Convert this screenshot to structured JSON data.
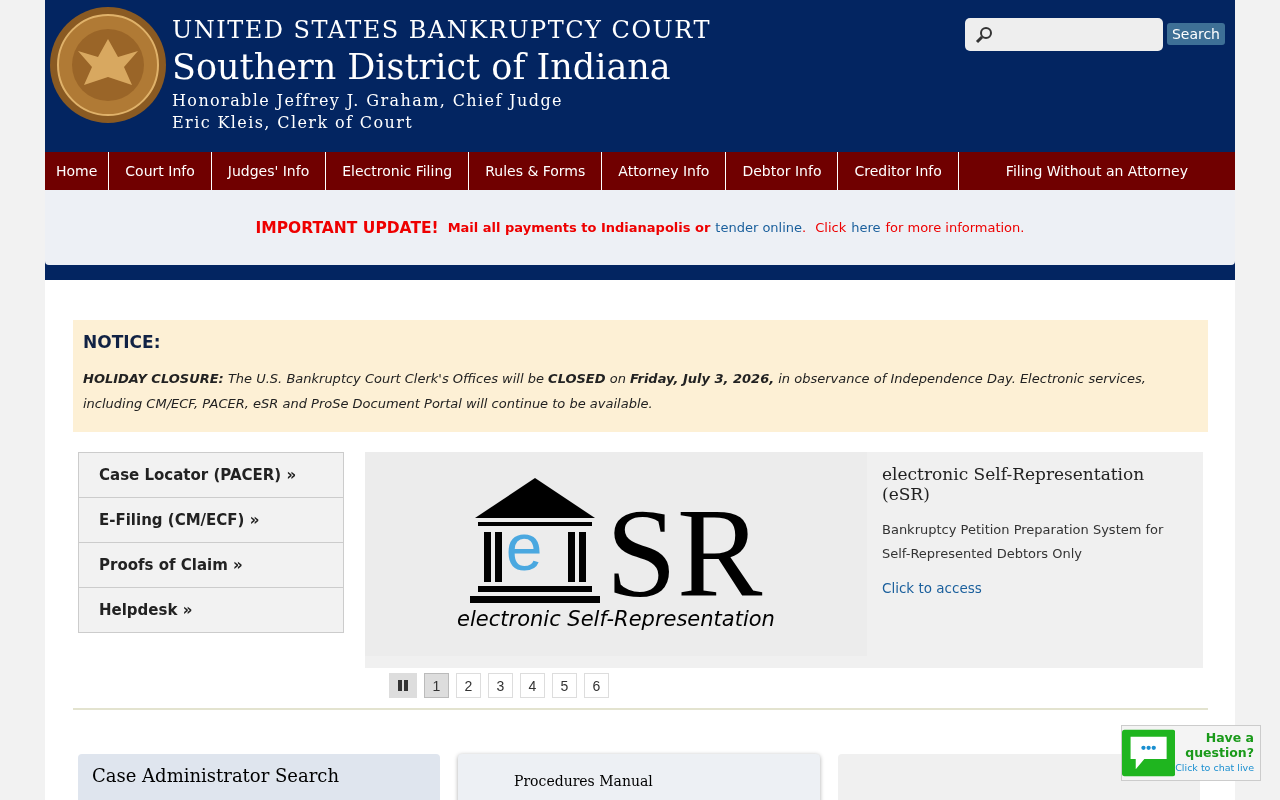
{
  "header": {
    "court": "UNITED STATES BANKRUPTCY COURT",
    "district": "Southern District of Indiana",
    "judge": "Honorable Jeffrey J. Graham, Chief Judge",
    "clerk": "Eric Kleis, Clerk of Court"
  },
  "search": {
    "button": "Search"
  },
  "nav": [
    {
      "label": "Home"
    },
    {
      "label": "Court Info"
    },
    {
      "label": "Judges' Info"
    },
    {
      "label": "Electronic Filing"
    },
    {
      "label": "Rules & Forms"
    },
    {
      "label": "Attorney Info"
    },
    {
      "label": "Debtor Info"
    },
    {
      "label": "Creditor Info"
    },
    {
      "label": "Filing Without an Attorney"
    }
  ],
  "update": {
    "headline": "IMPORTANT UPDATE!",
    "text": "Mail all payments to Indianapolis or",
    "link": "tender online",
    "after": ".",
    "click": "Click",
    "here": "here",
    "tail": "for more information."
  },
  "notice": {
    "title": "NOTICE:",
    "text": "**HOLIDAY CLOSURE:** The U.S. Bankruptcy Court Clerk's Offices will be **CLOSED** on **Friday, July 3, 2026,** in observance of Independence Day. Electronic services, including CM/ECF, PACER, eSR and ProSe Document Portal will continue to be available."
  },
  "quick_links": [
    {
      "label": "Case Locator (PACER) »"
    },
    {
      "label": "E-Filing (CM/ECF) »"
    },
    {
      "label": "Proofs of Claim »"
    },
    {
      "label": "Helpdesk »"
    }
  ],
  "slide": {
    "logo_letter": "e",
    "logo_text": "SR",
    "logo_tagline": "electronic Self-Representation",
    "title": "electronic Self-Representation (eSR)",
    "description": "Bankruptcy Petition Preparation System for Self-Represented Debtors Only",
    "link": "Click to access"
  },
  "pager": [
    {
      "label": "1",
      "selected": true
    },
    {
      "label": "2",
      "selected": false
    },
    {
      "label": "3",
      "selected": false
    },
    {
      "label": "4",
      "selected": false
    },
    {
      "label": "5",
      "selected": false
    },
    {
      "label": "6",
      "selected": false
    }
  ],
  "cards": [
    {
      "title": "Case Administrator Search"
    },
    {
      "title": "Procedures Manual"
    }
  ],
  "chat": {
    "line1": "Have a",
    "line2": "question?",
    "link": "Click to chat live"
  }
}
